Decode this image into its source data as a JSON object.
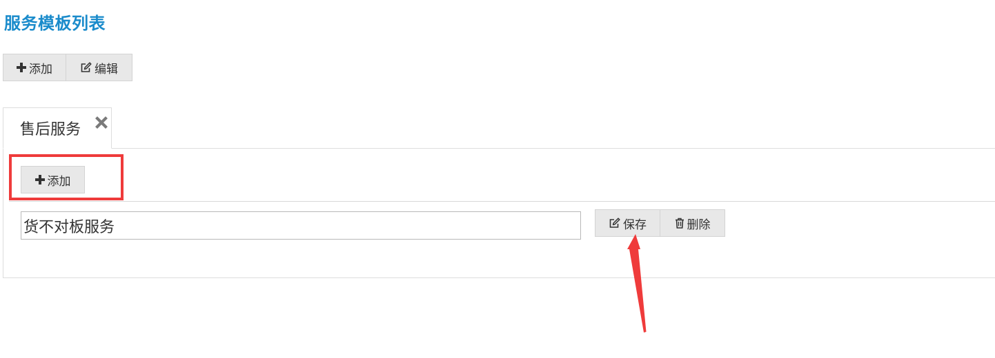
{
  "page": {
    "title": "服务模板列表"
  },
  "toolbar": {
    "add_label": "添加",
    "edit_label": "编辑"
  },
  "tabs": [
    {
      "label": "售后服务",
      "active": true,
      "closable": true
    }
  ],
  "panel": {
    "add_label": "添加",
    "items": [
      {
        "value": "货不对板服务",
        "save_label": "保存",
        "delete_label": "删除"
      }
    ]
  },
  "icons": {
    "add": "plus-icon",
    "edit": "edit-icon",
    "close": "close-icon",
    "save": "edit-icon",
    "delete": "trash-icon"
  },
  "colors": {
    "title": "#1a8bcb",
    "button_bg": "#e8e8e8",
    "annotation": "#ef3b3b"
  }
}
